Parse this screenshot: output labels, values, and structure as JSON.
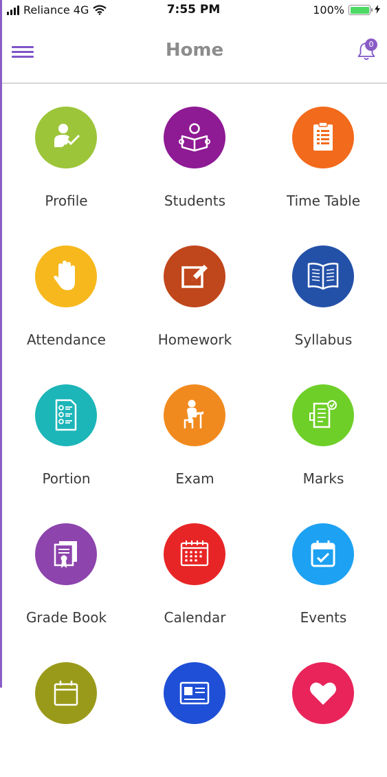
{
  "status_bar": {
    "carrier": "Reliance 4G",
    "time": "7:55 PM",
    "battery": "100%"
  },
  "header": {
    "title": "Home",
    "notification_count": "0"
  },
  "menu_items": [
    {
      "label": "Profile",
      "color": "#9cc53a",
      "icon": "profile-icon"
    },
    {
      "label": "Students",
      "color": "#8e1a94",
      "icon": "student-reading-icon"
    },
    {
      "label": "Time Table",
      "color": "#f26a1b",
      "icon": "clipboard-list-icon"
    },
    {
      "label": "Attendance",
      "color": "#f6b81c",
      "icon": "raised-hand-icon"
    },
    {
      "label": "Homework",
      "color": "#c0461b",
      "icon": "edit-note-icon"
    },
    {
      "label": "Syllabus",
      "color": "#2451a8",
      "icon": "open-book-icon"
    },
    {
      "label": "Portion",
      "color": "#1cb5b8",
      "icon": "document-list-icon"
    },
    {
      "label": "Exam",
      "color": "#f18a1e",
      "icon": "student-desk-icon"
    },
    {
      "label": "Marks",
      "color": "#6fcf29",
      "icon": "marksheet-icon"
    },
    {
      "label": "Grade Book",
      "color": "#8d44ad",
      "icon": "certificate-icon"
    },
    {
      "label": "Calendar",
      "color": "#e82526",
      "icon": "calendar-grid-icon"
    },
    {
      "label": "Events",
      "color": "#1da1f2",
      "icon": "calendar-check-icon"
    },
    {
      "label": "",
      "color": "#9a9a1a",
      "icon": "calendar-icon"
    },
    {
      "label": "",
      "color": "#1f4fd6",
      "icon": "id-card-icon"
    },
    {
      "label": "",
      "color": "#e8245a",
      "icon": "heart-icon"
    }
  ]
}
